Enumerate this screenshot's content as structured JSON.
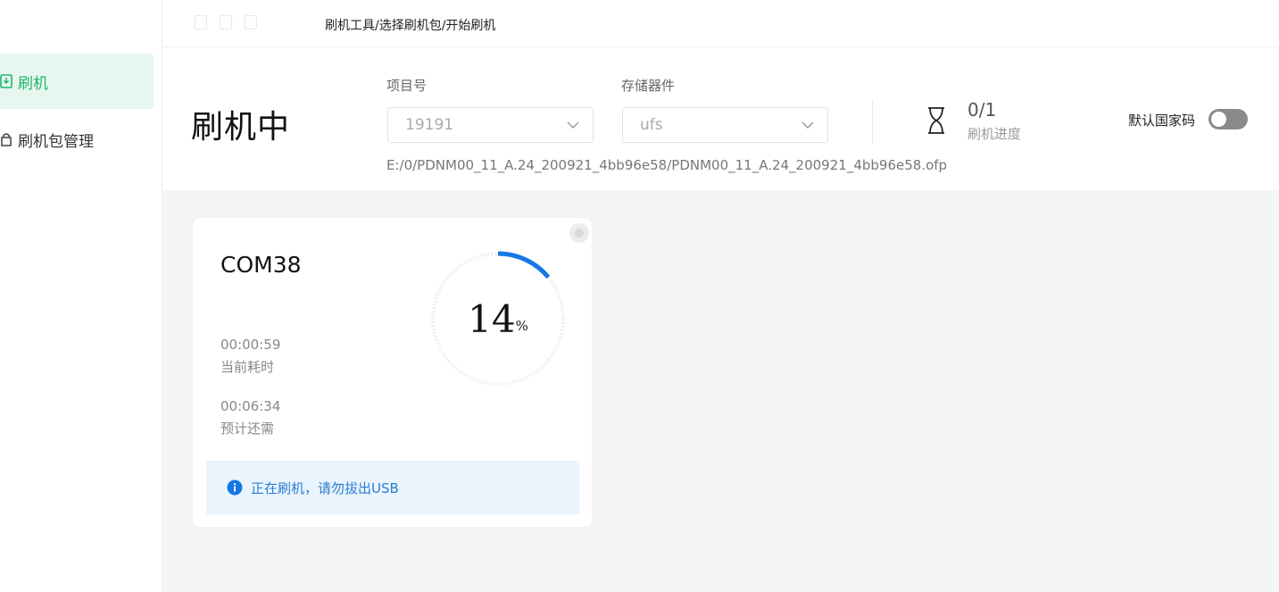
{
  "breadcrumb": "刷机工具/选择刷机包/开始刷机",
  "sidebar": {
    "items": [
      {
        "label": "刷机",
        "icon": "flash-icon",
        "active": true
      },
      {
        "label": "刷机包管理",
        "icon": "package-icon",
        "active": false
      }
    ]
  },
  "header": {
    "title": "刷机中",
    "project_label": "项目号",
    "project_value": "19191",
    "storage_label": "存储器件",
    "storage_value": "ufs",
    "file_path": "E:/0/PDNM00_11_A.24_200921_4bb96e58/PDNM00_11_A.24_200921_4bb96e58.ofp",
    "progress_count": "0/1",
    "progress_label": "刷机进度",
    "country_code_label": "默认国家码",
    "country_code_enabled": false
  },
  "device_card": {
    "port": "COM38",
    "elapsed_value": "00:00:59",
    "elapsed_label": "当前耗时",
    "remaining_value": "00:06:34",
    "remaining_label": "预计还需",
    "percent": "14",
    "percent_unit": "%",
    "progress_fraction": 0.14,
    "notice": "正在刷机，请勿拔出USB"
  },
  "colors": {
    "accent_green": "#1fb56d",
    "active_bg": "#e7f7ef",
    "progress_blue": "#1677e6",
    "notice_bg": "#eaf4fd",
    "notice_text": "#2a7dd1",
    "toggle_off": "#8a8a8a"
  }
}
